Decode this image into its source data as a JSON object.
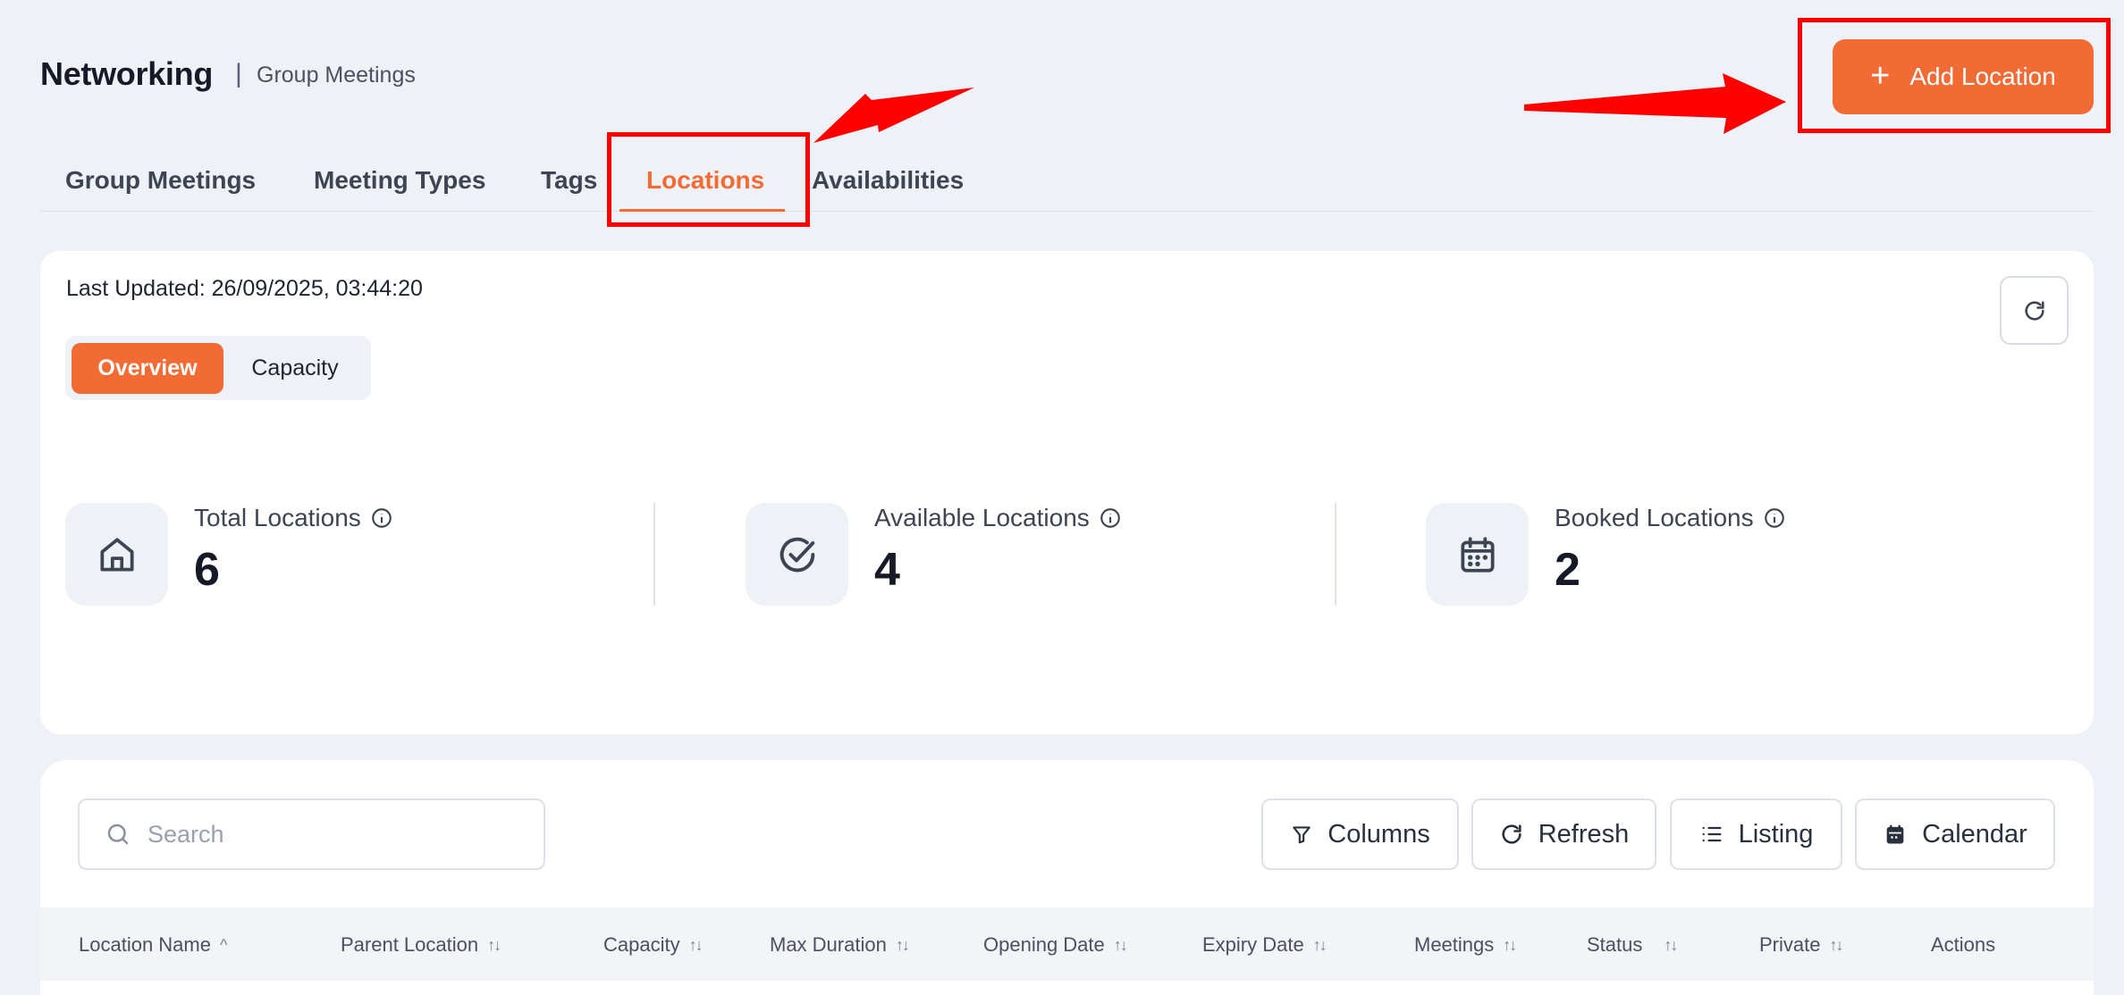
{
  "header": {
    "app_title": "Networking",
    "separator": "|",
    "subtitle": "Group Meetings",
    "add_button_label": "Add Location",
    "add_button_icon": "plus-icon"
  },
  "tabs": [
    {
      "label": "Group Meetings",
      "active": false
    },
    {
      "label": "Meeting Types",
      "active": false
    },
    {
      "label": "Tags",
      "active": false
    },
    {
      "label": "Locations",
      "active": true
    },
    {
      "label": "Availabilities",
      "active": false
    }
  ],
  "summary": {
    "last_updated": "Last Updated: 26/09/2025, 03:44:20",
    "segments": [
      "Overview",
      "Capacity"
    ],
    "active_segment": "Overview",
    "stats": [
      {
        "label": "Total Locations",
        "value": "6",
        "icon": "home-icon"
      },
      {
        "label": "Available Locations",
        "value": "4",
        "icon": "check-circle-icon"
      },
      {
        "label": "Booked Locations",
        "value": "2",
        "icon": "calendar-icon"
      }
    ]
  },
  "toolbar": {
    "search_placeholder": "Search",
    "buttons": [
      {
        "label": "Columns",
        "icon": "filter-icon"
      },
      {
        "label": "Refresh",
        "icon": "refresh-icon"
      },
      {
        "label": "Listing",
        "icon": "list-icon"
      },
      {
        "label": "Calendar",
        "icon": "calendar-icon"
      }
    ]
  },
  "table": {
    "columns": [
      {
        "label": "Location Name",
        "sort": "^"
      },
      {
        "label": "Parent Location",
        "sort": "↑↓"
      },
      {
        "label": "Capacity",
        "sort": "↑↓"
      },
      {
        "label": "Max Duration",
        "sort": "↑↓"
      },
      {
        "label": "Opening Date",
        "sort": "↑↓"
      },
      {
        "label": "Expiry Date",
        "sort": "↑↓"
      },
      {
        "label": "Meetings",
        "sort": "↑↓"
      },
      {
        "label": "Status",
        "sort": "↑↓"
      },
      {
        "label": "Private",
        "sort": "↑↓"
      },
      {
        "label": "Actions",
        "sort": ""
      }
    ]
  },
  "colors": {
    "accent": "#f26b35",
    "annotation": "#ff0000",
    "background": "#eef1f6"
  }
}
